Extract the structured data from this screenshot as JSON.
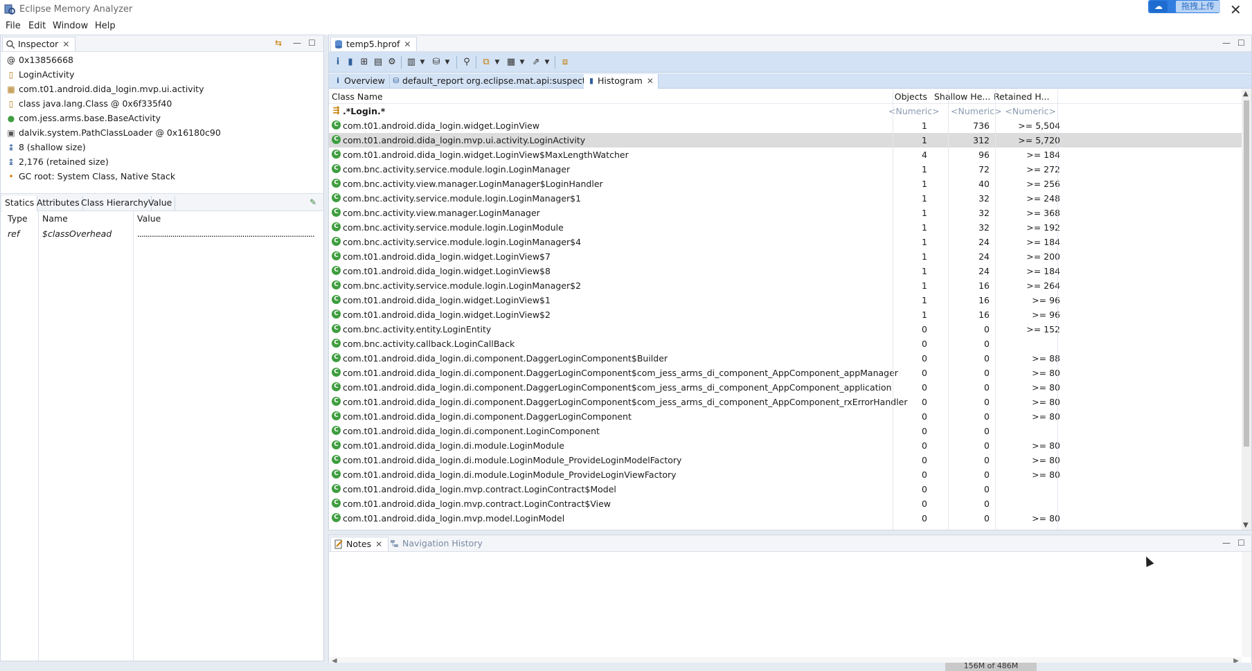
{
  "window": {
    "title": "Eclipse Memory Analyzer",
    "upload_label": "拖拽上传"
  },
  "menu": [
    "File",
    "Edit",
    "Window",
    "Help"
  ],
  "inspector": {
    "tab_label": "Inspector",
    "rows": [
      {
        "icon": "at-icon",
        "text": "0x13856668"
      },
      {
        "icon": "class-icon",
        "text": "LoginActivity"
      },
      {
        "icon": "package-icon",
        "text": "com.t01.android.dida_login.mvp.ui.activity"
      },
      {
        "icon": "class-icon",
        "text": "class java.lang.Class @ 0x6f335f40"
      },
      {
        "icon": "superclass-icon",
        "text": "com.jess.arms.base.BaseActivity"
      },
      {
        "icon": "classloader-icon",
        "text": "dalvik.system.PathClassLoader @ 0x16180c90"
      },
      {
        "icon": "shallow-size-icon",
        "text": "8 (shallow size)"
      },
      {
        "icon": "retained-size-icon",
        "text": "2,176 (retained size)"
      },
      {
        "icon": "gc-root-icon",
        "text": "GC root: System Class, Native Stack"
      }
    ],
    "tabs": [
      "Statics",
      "Attributes",
      "Class Hierarchy",
      "Value"
    ],
    "table_headers": [
      "Type",
      "Name",
      "Value"
    ],
    "table_rows": [
      {
        "type": "ref",
        "name": "$classOverhead",
        "value": "......................................................................................"
      }
    ]
  },
  "editor": {
    "tab_label": "temp5.hprof",
    "subtabs": [
      "Overview",
      "default_report  org.eclipse.mat.api:suspects",
      "Histogram"
    ],
    "headers": {
      "class_name": "Class Name",
      "objects": "Objects",
      "shallow": "Shallow He...",
      "retained": "Retained H..."
    },
    "filter": {
      "class_name": ".*Login.*",
      "objects": "<Numeric>",
      "shallow": "<Numeric>",
      "retained": "<Numeric>"
    },
    "rows": [
      {
        "name": "com.t01.android.dida_login.widget.LoginView",
        "objects": "1",
        "shallow": "736",
        "retained": ">= 5,504"
      },
      {
        "name": "com.t01.android.dida_login.mvp.ui.activity.LoginActivity",
        "objects": "1",
        "shallow": "312",
        "retained": ">= 5,720"
      },
      {
        "name": "com.t01.android.dida_login.widget.LoginView$MaxLengthWatcher",
        "objects": "4",
        "shallow": "96",
        "retained": ">= 184"
      },
      {
        "name": "com.bnc.activity.service.module.login.LoginManager",
        "objects": "1",
        "shallow": "72",
        "retained": ">= 272"
      },
      {
        "name": "com.bnc.activity.view.manager.LoginManager$LoginHandler",
        "objects": "1",
        "shallow": "40",
        "retained": ">= 256"
      },
      {
        "name": "com.bnc.activity.service.module.login.LoginManager$1",
        "objects": "1",
        "shallow": "32",
        "retained": ">= 248"
      },
      {
        "name": "com.bnc.activity.view.manager.LoginManager",
        "objects": "1",
        "shallow": "32",
        "retained": ">= 368"
      },
      {
        "name": "com.bnc.activity.service.module.login.LoginModule",
        "objects": "1",
        "shallow": "32",
        "retained": ">= 192"
      },
      {
        "name": "com.bnc.activity.service.module.login.LoginManager$4",
        "objects": "1",
        "shallow": "24",
        "retained": ">= 184"
      },
      {
        "name": "com.t01.android.dida_login.widget.LoginView$7",
        "objects": "1",
        "shallow": "24",
        "retained": ">= 200"
      },
      {
        "name": "com.t01.android.dida_login.widget.LoginView$8",
        "objects": "1",
        "shallow": "24",
        "retained": ">= 184"
      },
      {
        "name": "com.bnc.activity.service.module.login.LoginManager$2",
        "objects": "1",
        "shallow": "16",
        "retained": ">= 264"
      },
      {
        "name": "com.t01.android.dida_login.widget.LoginView$1",
        "objects": "1",
        "shallow": "16",
        "retained": ">= 96"
      },
      {
        "name": "com.t01.android.dida_login.widget.LoginView$2",
        "objects": "1",
        "shallow": "16",
        "retained": ">= 96"
      },
      {
        "name": "com.bnc.activity.entity.LoginEntity",
        "objects": "0",
        "shallow": "0",
        "retained": ">= 152"
      },
      {
        "name": "com.bnc.activity.callback.LoginCallBack",
        "objects": "0",
        "shallow": "0",
        "retained": ""
      },
      {
        "name": "com.t01.android.dida_login.di.component.DaggerLoginComponent$Builder",
        "objects": "0",
        "shallow": "0",
        "retained": ">= 88"
      },
      {
        "name": "com.t01.android.dida_login.di.component.DaggerLoginComponent$com_jess_arms_di_component_AppComponent_appManager",
        "objects": "0",
        "shallow": "0",
        "retained": ">= 80"
      },
      {
        "name": "com.t01.android.dida_login.di.component.DaggerLoginComponent$com_jess_arms_di_component_AppComponent_application",
        "objects": "0",
        "shallow": "0",
        "retained": ">= 80"
      },
      {
        "name": "com.t01.android.dida_login.di.component.DaggerLoginComponent$com_jess_arms_di_component_AppComponent_rxErrorHandler",
        "objects": "0",
        "shallow": "0",
        "retained": ">= 80"
      },
      {
        "name": "com.t01.android.dida_login.di.component.DaggerLoginComponent",
        "objects": "0",
        "shallow": "0",
        "retained": ">= 80"
      },
      {
        "name": "com.t01.android.dida_login.di.component.LoginComponent",
        "objects": "0",
        "shallow": "0",
        "retained": ""
      },
      {
        "name": "com.t01.android.dida_login.di.module.LoginModule",
        "objects": "0",
        "shallow": "0",
        "retained": ">= 80"
      },
      {
        "name": "com.t01.android.dida_login.di.module.LoginModule_ProvideLoginModelFactory",
        "objects": "0",
        "shallow": "0",
        "retained": ">= 80"
      },
      {
        "name": "com.t01.android.dida_login.di.module.LoginModule_ProvideLoginViewFactory",
        "objects": "0",
        "shallow": "0",
        "retained": ">= 80"
      },
      {
        "name": "com.t01.android.dida_login.mvp.contract.LoginContract$Model",
        "objects": "0",
        "shallow": "0",
        "retained": ""
      },
      {
        "name": "com.t01.android.dida_login.mvp.contract.LoginContract$View",
        "objects": "0",
        "shallow": "0",
        "retained": ""
      },
      {
        "name": "com.t01.android.dida_login.mvp.model.LoginModel",
        "objects": "0",
        "shallow": "0",
        "retained": ">= 80"
      }
    ],
    "selected_index": 1
  },
  "bottom": {
    "tabs": [
      "Notes",
      "Navigation History"
    ]
  },
  "status": {
    "heap": "156M of 486M"
  },
  "colors": {
    "toolbar_bg": "#d3e2f4",
    "selection": "#dcdcdc",
    "class_icon": "#3f9d3f"
  }
}
